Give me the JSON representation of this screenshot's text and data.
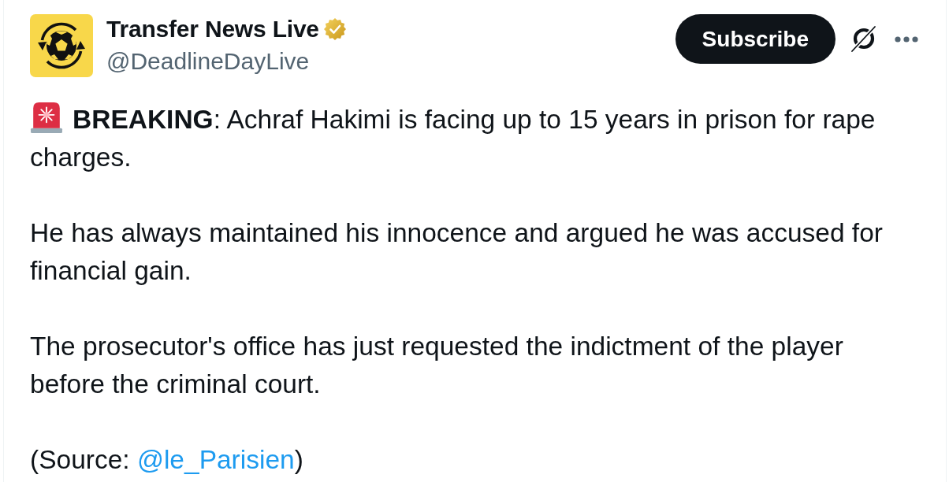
{
  "account": {
    "name": "Transfer News Live",
    "verified": true,
    "handle": "@DeadlineDayLive"
  },
  "header_actions": {
    "subscribe_label": "Subscribe"
  },
  "post": {
    "paragraphs": [
      {
        "kind": "alert",
        "text": "**BREAKING**: Achraf Hakimi is facing up to 15 years in prison for rape charges."
      },
      {
        "kind": "plain",
        "text": "He has always maintained his innocence and argued he was accused for financial gain."
      },
      {
        "kind": "plain",
        "text": "The prosecutor's office has just requested the indictment of the player before the criminal court."
      },
      {
        "kind": "source",
        "text": "(Source: ",
        "link": "@le_Parisien",
        "text_after": ")"
      }
    ]
  }
}
